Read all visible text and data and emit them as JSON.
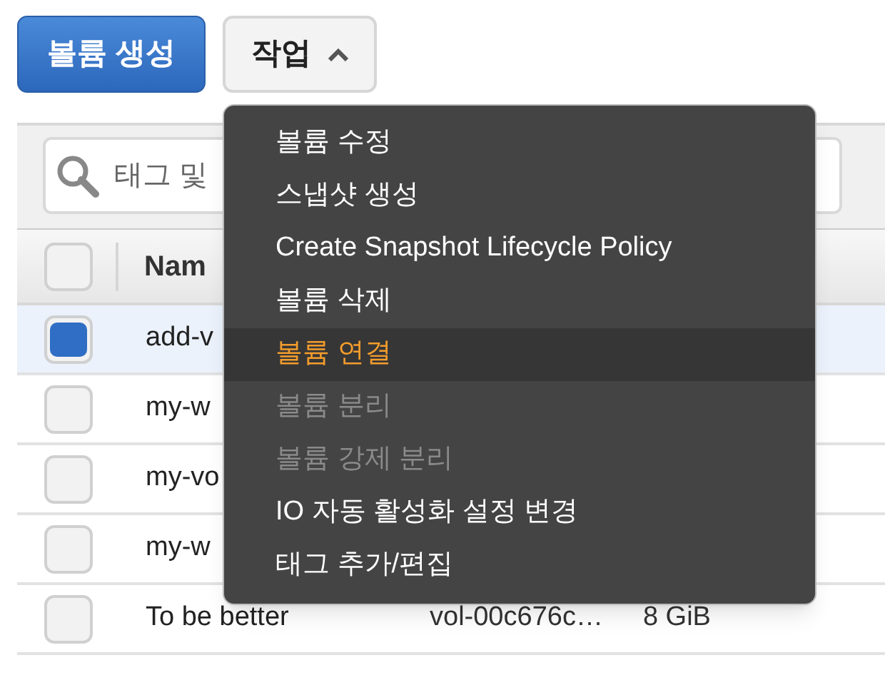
{
  "toolbar": {
    "create_button": "볼륨 생성",
    "actions_button": {
      "label": "작업",
      "expanded": true
    }
  },
  "search": {
    "placeholder": "태그 및"
  },
  "table": {
    "columns": [
      {
        "label": "Nam"
      }
    ],
    "select_all": {
      "checked": false
    },
    "rows": [
      {
        "selected": true,
        "name": "add-v"
      },
      {
        "selected": false,
        "name": "my-w"
      },
      {
        "selected": false,
        "name": "my-vo"
      },
      {
        "selected": false,
        "name": "my-w"
      },
      {
        "selected": false,
        "name": "To be better",
        "volume_id": "vol-00c676c…",
        "size": "8 GiB"
      }
    ]
  },
  "actions_menu": {
    "items": [
      {
        "label": "볼륨 수정",
        "disabled": false,
        "selected": false
      },
      {
        "label": "스냅샷 생성",
        "disabled": false,
        "selected": false
      },
      {
        "label": "Create Snapshot Lifecycle Policy",
        "disabled": false,
        "selected": false
      },
      {
        "label": "볼륨 삭제",
        "disabled": false,
        "selected": false
      },
      {
        "label": "볼륨 연결",
        "disabled": false,
        "selected": true
      },
      {
        "label": "볼륨 분리",
        "disabled": true,
        "selected": false
      },
      {
        "label": "볼륨 강제 분리",
        "disabled": true,
        "selected": false
      },
      {
        "label": "IO 자동 활성화 설정 변경",
        "disabled": false,
        "selected": false
      },
      {
        "label": "태그 추가/편집",
        "disabled": false,
        "selected": false
      }
    ]
  }
}
